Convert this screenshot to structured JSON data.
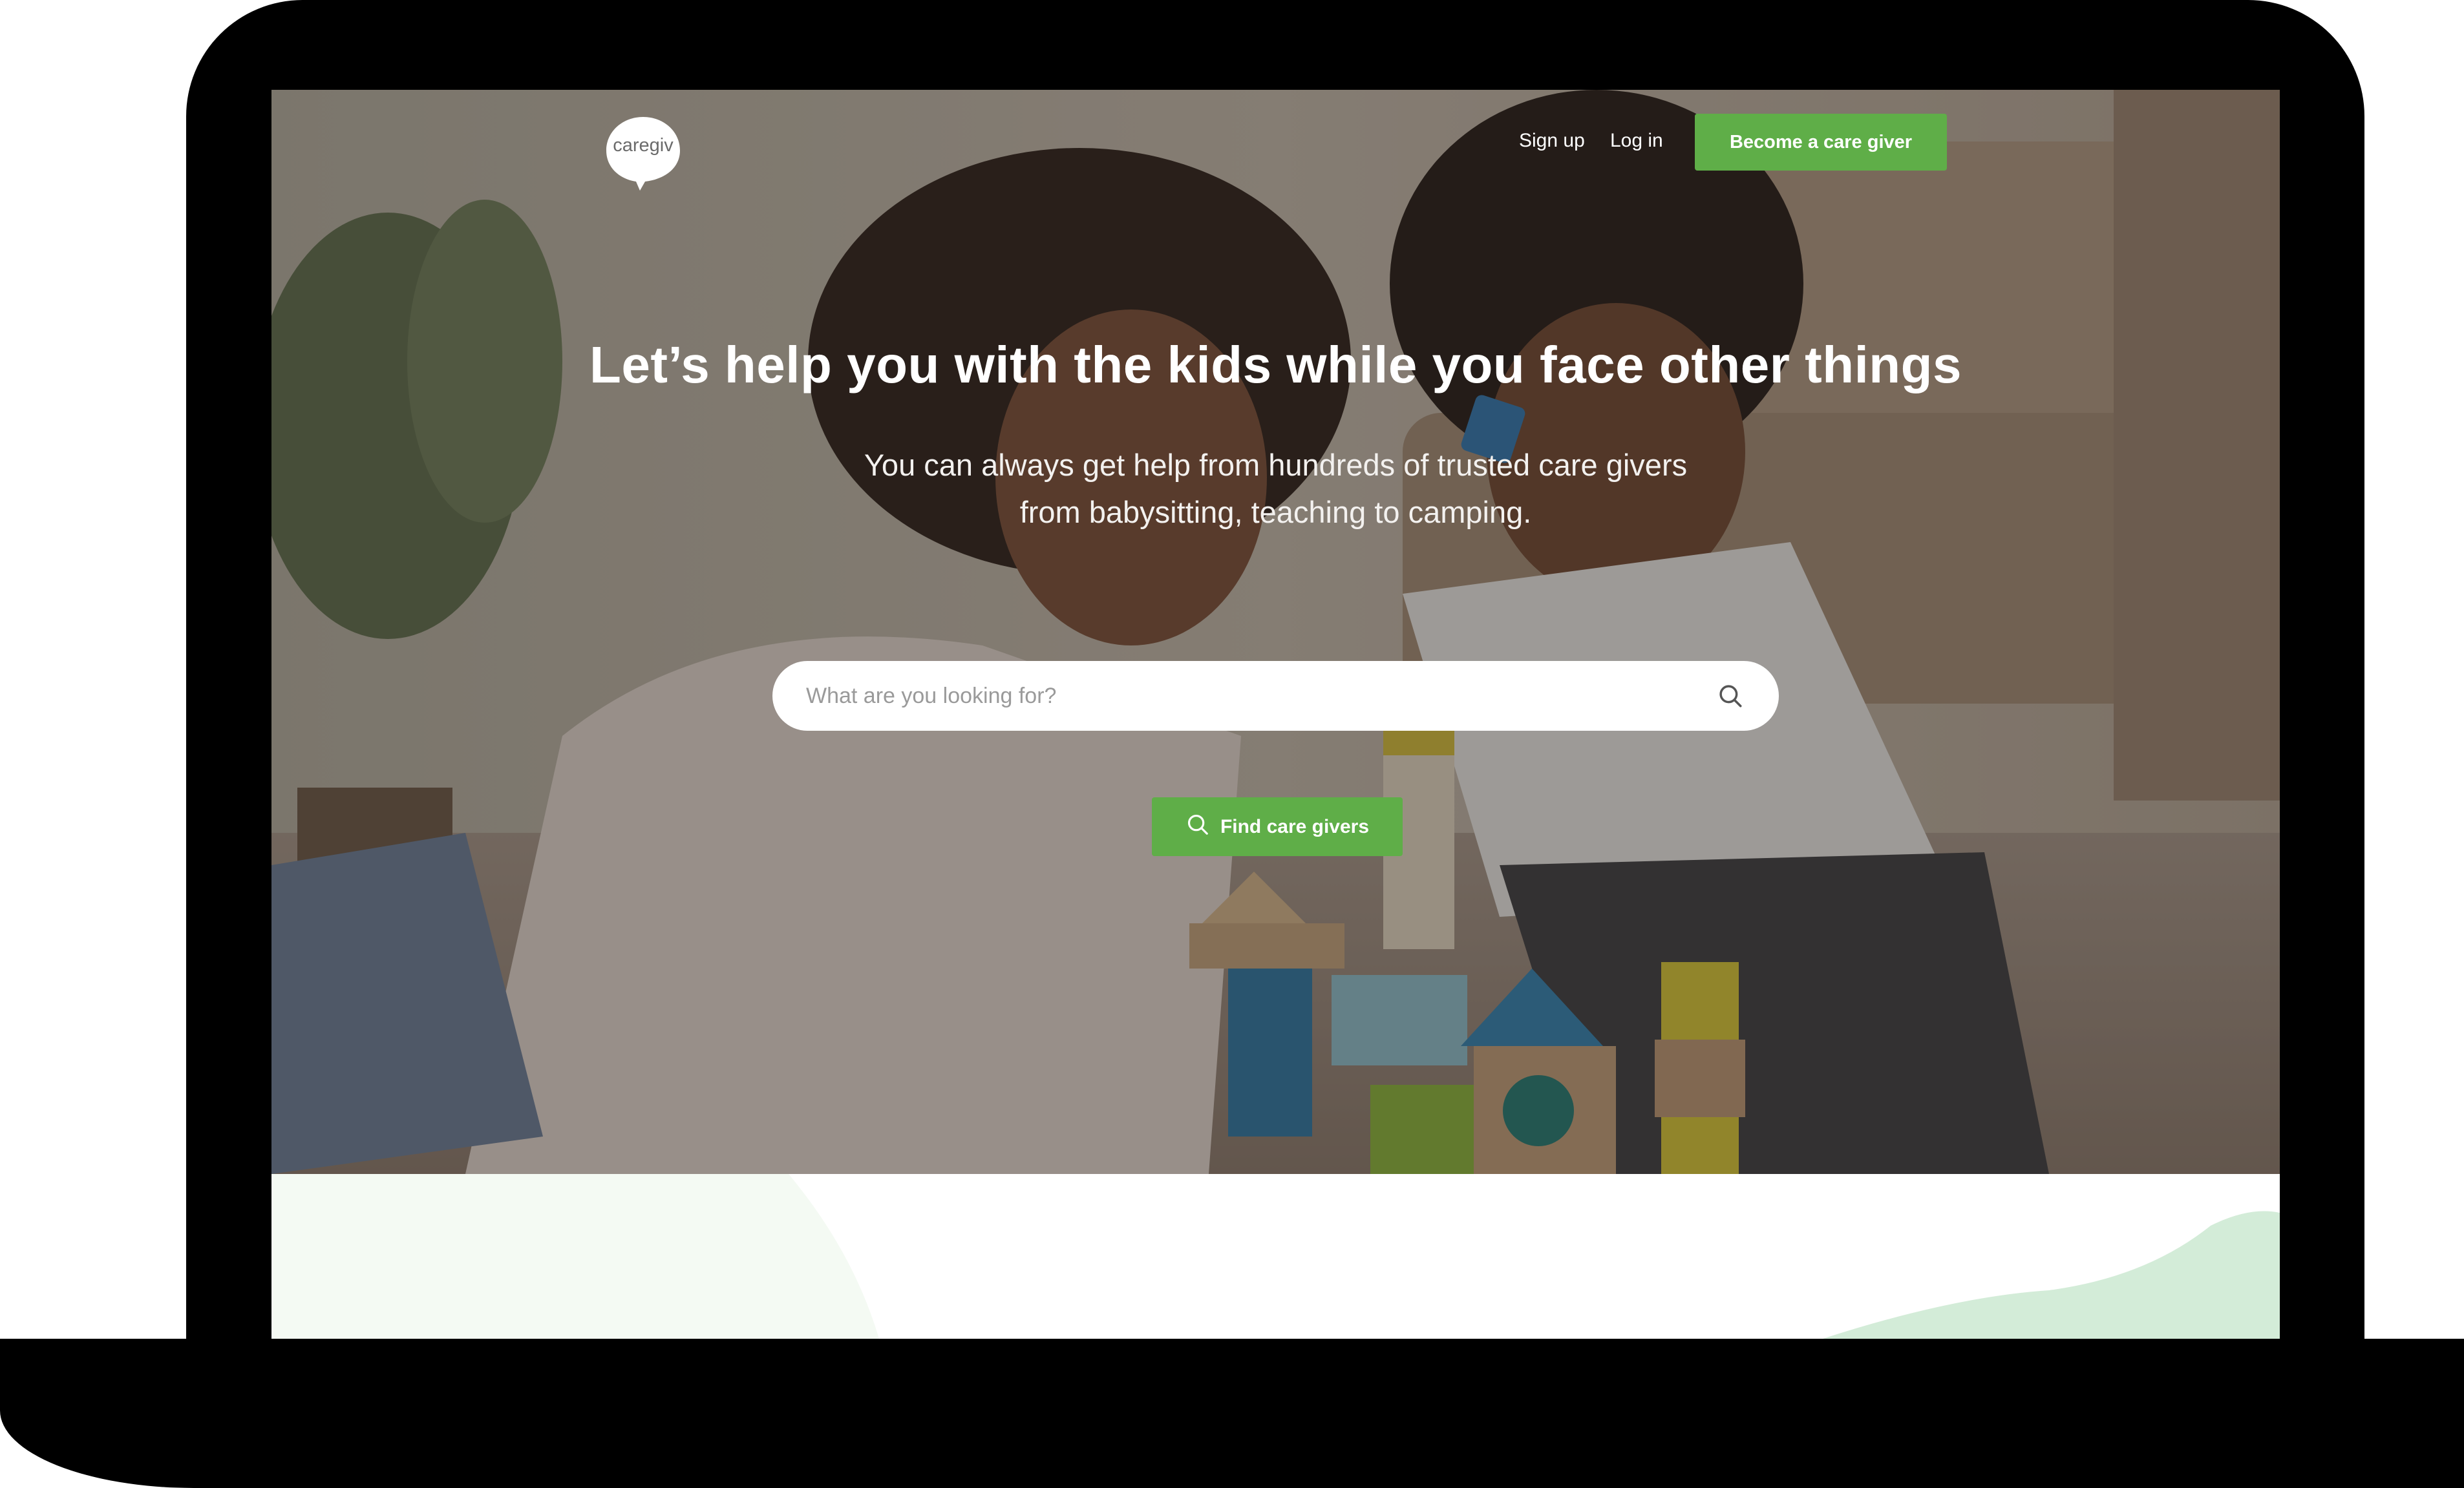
{
  "brand": {
    "logo_text": "caregiv",
    "accent_color": "#5fae48"
  },
  "nav": {
    "signup_label": "Sign up",
    "login_label": "Log in",
    "cta_label": "Become a care giver"
  },
  "hero": {
    "headline": "Let’s help you with the kids while you face other things",
    "subtitle_line1": "You can always get help from hundreds of trusted care givers",
    "subtitle_line2": "from babysitting, teaching to camping.",
    "search": {
      "placeholder": "What are you looking for?",
      "value": "",
      "icon": "search-icon"
    },
    "find_button_label": "Find care givers",
    "find_button_icon": "search-icon"
  }
}
